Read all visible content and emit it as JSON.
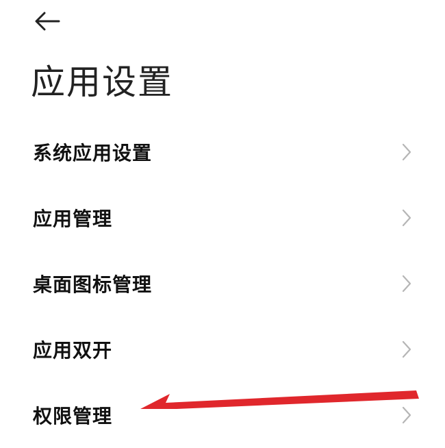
{
  "header": {
    "back_icon": "arrow-left-icon",
    "title": "应用设置"
  },
  "menu": {
    "items": [
      {
        "label": "系统应用设置",
        "icon": "chevron-right-icon"
      },
      {
        "label": "应用管理",
        "icon": "chevron-right-icon"
      },
      {
        "label": "桌面图标管理",
        "icon": "chevron-right-icon"
      },
      {
        "label": "应用双开",
        "icon": "chevron-right-icon"
      },
      {
        "label": "权限管理",
        "icon": "chevron-right-icon"
      }
    ]
  },
  "annotation": {
    "color": "#e0272c"
  },
  "colors": {
    "background": "#ffffff",
    "text": "#111111",
    "chevron": "#b5b5b5"
  }
}
